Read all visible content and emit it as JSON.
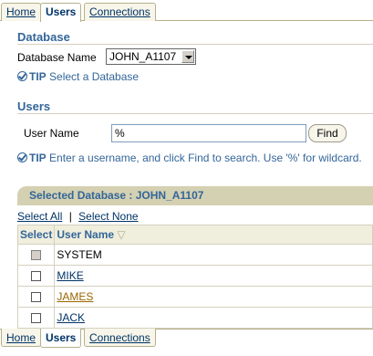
{
  "tabs": [
    {
      "label": "Home",
      "active": false
    },
    {
      "label": "Users",
      "active": true
    },
    {
      "label": "Connections",
      "active": false
    }
  ],
  "database_section": {
    "title": "Database",
    "field_label": "Database Name",
    "selected_value": "JOHN_A1107",
    "tip_label": "TIP",
    "tip_text": "Select a Database"
  },
  "users_section": {
    "title": "Users",
    "field_label": "User Name",
    "input_value": "%",
    "find_button": "Find",
    "tip_label": "TIP",
    "tip_text": "Enter a username, and click Find to search. Use '%' for wildcard."
  },
  "results": {
    "header": "Selected Database : JOHN_A1107",
    "select_all": "Select All",
    "separator": "|",
    "select_none": "Select None",
    "columns": [
      "Select",
      "User Name"
    ],
    "sort_indicator": "▽",
    "rows": [
      {
        "name": "SYSTEM",
        "link": false,
        "selectable": false
      },
      {
        "name": "MIKE",
        "link": true,
        "selectable": true
      },
      {
        "name": "JAMES",
        "link": true,
        "selectable": true
      },
      {
        "name": "JACK",
        "link": true,
        "selectable": true
      }
    ]
  },
  "colors": {
    "accent": "#336699",
    "tab_border": "#b5b08c",
    "table_bar": "#d4d0b2",
    "link_visited": "#996600"
  }
}
